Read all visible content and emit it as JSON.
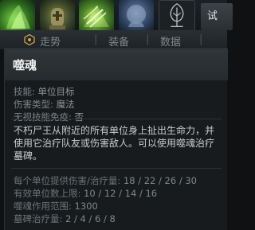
{
  "topbar": {
    "slots": [
      {
        "icon": "ghost-hero-portrait-icon"
      },
      {
        "icon": "tombstone-ability-icon"
      },
      {
        "icon": "soul-rip-ability-icon"
      },
      {
        "icon": "dark-shroud-ability-icon"
      },
      {
        "icon": "tree-talent-icon"
      }
    ],
    "try_label": "试"
  },
  "tabs": {
    "stats_label": "走势",
    "sep1": "|",
    "gear_label": "装备",
    "sep2": "|",
    "data_label": "数据",
    "sep3": "|"
  },
  "tooltip": {
    "ability_name": "噬魂",
    "stats": [
      {
        "label": "技能:",
        "value": "单位目标"
      },
      {
        "label": "伤害类型:",
        "value": "魔法"
      },
      {
        "label": "无视技能免疫:",
        "value": "否"
      }
    ],
    "description": "不朽尸王从附近的所有单位身上扯出生命力，并使用它治疗队友或伤害敌人。可以使用噬魂治疗墓碑。",
    "specials": [
      {
        "label": "每个单位提供伤害/治疗量:",
        "value": "18 / 22 / 26 / 30"
      },
      {
        "label": "有效单位数上限:",
        "value": "10 / 12 / 14 / 16"
      },
      {
        "label": "噬魂作用范围:",
        "value": "1300"
      },
      {
        "label": "墓碑治疗量:",
        "value": "2 / 4 / 6 / 8"
      }
    ]
  },
  "colors": {
    "background": "#0f1112",
    "panel": "#181b1d",
    "title_bar": "#2f3538",
    "text_main": "#c9cbcc",
    "text_muted": "#7d8488"
  }
}
